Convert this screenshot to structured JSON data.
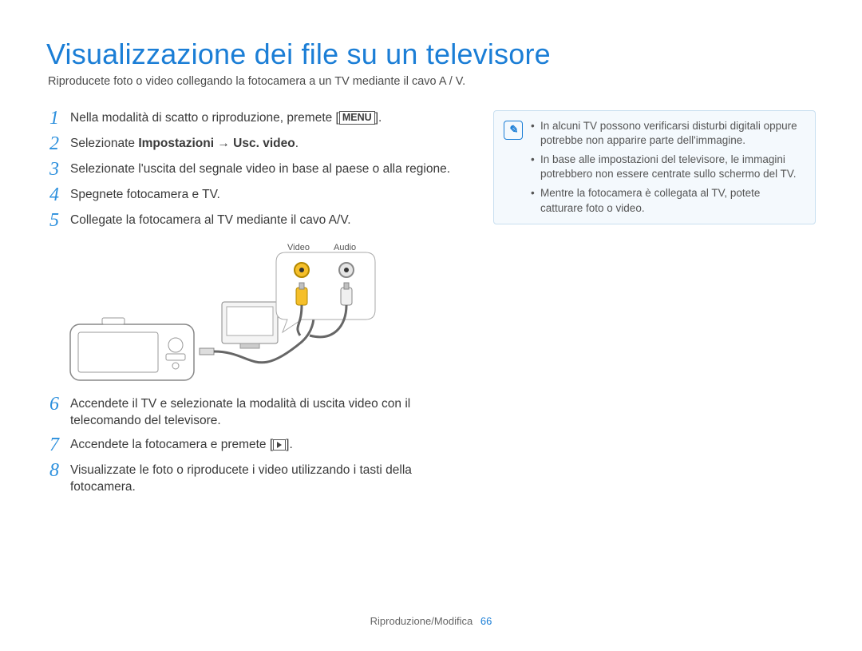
{
  "title": "Visualizzazione dei file su un televisore",
  "subtitle": "Riproducete foto o video collegando la fotocamera a un TV mediante il cavo A / V.",
  "steps": {
    "s1_a": "Nella modalità di scatto o riproduzione, premete [",
    "s1_b": "].",
    "s2_a": "Selezionate ",
    "s2_b": "Impostazioni → Usc. video",
    "s2_c": ".",
    "s3": "Selezionate l'uscita del segnale video in base al paese o alla regione.",
    "s4": "Spegnete fotocamera e TV.",
    "s5": "Collegate la fotocamera al TV mediante il cavo A/V.",
    "s6": "Accendete il TV e selezionate la modalità di uscita video con il telecomando del televisore.",
    "s7_a": "Accendete la fotocamera e premete [",
    "s7_b": "].",
    "s8": "Visualizzate le foto o riproducete i video utilizzando i tasti della fotocamera."
  },
  "step_numbers": {
    "n1": "1",
    "n2": "2",
    "n3": "3",
    "n4": "4",
    "n5": "5",
    "n6": "6",
    "n7": "7",
    "n8": "8"
  },
  "menu_label": "MENU",
  "diagram": {
    "video": "Video",
    "audio": "Audio"
  },
  "notes": {
    "n1": "In alcuni TV possono verificarsi disturbi digitali oppure potrebbe non apparire parte dell'immagine.",
    "n2": "In base alle impostazioni del televisore, le immagini potrebbero non essere centrate sullo schermo del TV.",
    "n3": "Mentre la fotocamera è collegata al TV, potete catturare foto o video."
  },
  "footer": {
    "section": "Riproduzione/Modifica",
    "page_number": "66"
  }
}
